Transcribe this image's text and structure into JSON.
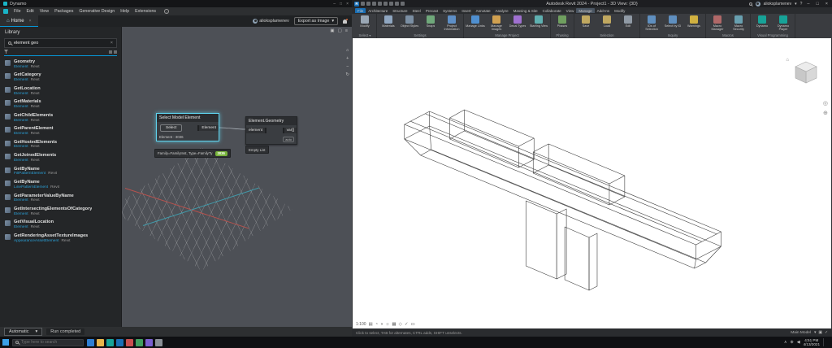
{
  "dynamo": {
    "window_title": "Dynamo",
    "window_controls": {
      "minimize": "–",
      "maximize": "□",
      "close": "×"
    },
    "menus": [
      {
        "label": "File"
      },
      {
        "label": "Edit"
      },
      {
        "label": "View"
      },
      {
        "label": "Packages"
      },
      {
        "label": "Generative Design"
      },
      {
        "label": "Help"
      },
      {
        "label": "Extensions"
      }
    ],
    "info_badge": "i",
    "home_tab": {
      "icon": "⌂",
      "label": "Home",
      "close": "×"
    },
    "account": {
      "user": "alioksplamenev"
    },
    "export_button": {
      "label": "Export as Image",
      "caret": "▾"
    },
    "library": {
      "title": "Library",
      "search": {
        "value": "element geo",
        "clear": "×"
      },
      "items": [
        {
          "name": "Geometry",
          "sub": "Element",
          "kind": "Revit"
        },
        {
          "name": "GetCategory",
          "sub": "Element",
          "kind": "Revit"
        },
        {
          "name": "GetLocation",
          "sub": "Element",
          "kind": "Revit"
        },
        {
          "name": "GetMaterials",
          "sub": "Element",
          "kind": "Revit"
        },
        {
          "name": "GetChildElements",
          "sub": "Element",
          "kind": "Revit"
        },
        {
          "name": "GetParentElement",
          "sub": "Element",
          "kind": "Revit"
        },
        {
          "name": "GetHostedElements",
          "sub": "Element",
          "kind": "Revit"
        },
        {
          "name": "GetJoinedElements",
          "sub": "Element",
          "kind": "Revit"
        },
        {
          "name": "GetByName",
          "sub": "FillPatternElement",
          "kind": "Revit"
        },
        {
          "name": "GetByName",
          "sub": "LinePatternElement",
          "kind": "Revit"
        },
        {
          "name": "GetParameterValueByName",
          "sub": "Element",
          "kind": "Revit"
        },
        {
          "name": "GetIntersectingElementsOfCategory",
          "sub": "Element",
          "kind": "Revit"
        },
        {
          "name": "GetVisualLocation",
          "sub": "Element",
          "kind": "Revit"
        },
        {
          "name": "GetRenderingAssetTextureImages",
          "sub": "AppearanceAssetElement",
          "kind": "Revit"
        }
      ]
    },
    "canvas": {
      "top_icons": [
        {
          "glyph": "▣",
          "name": "fit-view-icon"
        },
        {
          "glyph": "▢",
          "name": "zoom-window-icon"
        },
        {
          "glyph": "≡",
          "name": "canvas-menu-icon"
        }
      ],
      "side_icons": [
        {
          "glyph": "⌂",
          "name": "home-view-icon"
        },
        {
          "glyph": "+",
          "name": "zoom-in-icon"
        },
        {
          "glyph": "−",
          "name": "zoom-out-icon"
        },
        {
          "glyph": "↻",
          "name": "orbit-icon"
        }
      ],
      "select_node": {
        "title": "Select Model Element",
        "button": "Select",
        "out_port": "Element",
        "footer": "Element : 3036"
      },
      "watch": {
        "text": "Family=FamilyInst, Type=FamilyTy",
        "badge": "3036"
      },
      "geometry_node": {
        "title": "Element.Geometry",
        "in_port": "element",
        "out_port": "var[]",
        "lacing": "auto"
      },
      "preview_bubble": "Empty List"
    },
    "footer": {
      "run_mode": "Automatic",
      "caret": "▾",
      "status": "Run completed"
    }
  },
  "revit": {
    "title": "Autodesk Revit 2024 - Project1 - 3D View: {3D}",
    "qat": [
      {
        "name": "file-menu-icon"
      },
      {
        "name": "open-icon"
      },
      {
        "name": "save-icon"
      },
      {
        "name": "sync-icon"
      },
      {
        "name": "undo-icon"
      },
      {
        "name": "redo-icon"
      },
      {
        "name": "print-icon"
      },
      {
        "name": "measure-icon"
      }
    ],
    "titlebar_right": {
      "user": "alioksplamenev",
      "caret": "▾",
      "help": "?",
      "minimize": "–",
      "maximize": "□",
      "close": "×"
    },
    "tabs": [
      {
        "label": "File",
        "accent": "#1a6fb5"
      },
      {
        "label": "Architecture"
      },
      {
        "label": "Structure"
      },
      {
        "label": "Steel"
      },
      {
        "label": "Precast"
      },
      {
        "label": "Systems"
      },
      {
        "label": "Insert"
      },
      {
        "label": "Annotate"
      },
      {
        "label": "Analyze"
      },
      {
        "label": "Massing & Site"
      },
      {
        "label": "Collaborate"
      },
      {
        "label": "View"
      },
      {
        "label": "Manage",
        "accent": "#4a5562"
      },
      {
        "label": "Add-Ins"
      },
      {
        "label": "Modify"
      }
    ],
    "ribbon": {
      "panels": [
        {
          "caption": "Select ▾",
          "items": [
            {
              "label": "Modify",
              "color": "#9aa7b5"
            }
          ]
        },
        {
          "caption": "Settings",
          "items": [
            {
              "label": "Materials",
              "color": "#8fa6c0"
            },
            {
              "label": "Object Styles",
              "color": "#7b8fa3"
            },
            {
              "label": "Snaps",
              "color": "#6fa87a"
            },
            {
              "label": "Project Information",
              "color": "#5e8fc7"
            }
          ]
        },
        {
          "caption": "Manage Project",
          "items": [
            {
              "label": "Manage Links",
              "color": "#4f8fd0"
            },
            {
              "label": "Manage Images",
              "color": "#d0a050"
            },
            {
              "label": "Decal Types",
              "color": "#9f70d0"
            },
            {
              "label": "Starting View",
              "color": "#5fb0b0"
            }
          ]
        },
        {
          "caption": "Phasing",
          "items": [
            {
              "label": "Phases",
              "color": "#6f9f5f"
            }
          ]
        },
        {
          "caption": "Selection",
          "items": [
            {
              "label": "Save",
              "color": "#c0a860"
            },
            {
              "label": "Load",
              "color": "#c0a860"
            },
            {
              "label": "Edit",
              "color": "#909aa5"
            }
          ]
        },
        {
          "caption": "Inquiry",
          "items": [
            {
              "label": "IDs of Selection",
              "color": "#5f8fbf"
            },
            {
              "label": "Select by ID",
              "color": "#5f8fbf"
            },
            {
              "label": "Warnings",
              "color": "#d0b040"
            }
          ]
        },
        {
          "caption": "Macros",
          "items": [
            {
              "label": "Macro Manager",
              "color": "#b06868"
            },
            {
              "label": "Macro Security",
              "color": "#68a0b0"
            }
          ]
        },
        {
          "caption": "Visual Programming",
          "items": [
            {
              "label": "Dynamo",
              "color": "#17a398"
            },
            {
              "label": "Dynamo Player",
              "color": "#17a398"
            }
          ]
        }
      ]
    },
    "viewcube": {
      "home": "⌂"
    },
    "nav_icons": [
      {
        "glyph": "◎",
        "name": "steering-wheel-icon"
      },
      {
        "glyph": "⊕",
        "name": "zoom-icon"
      }
    ],
    "viewbar": {
      "scale": "1:100",
      "icons": [
        {
          "glyph": "▤",
          "name": "detail-level-icon"
        },
        {
          "glyph": "◔",
          "name": "visual-style-icon"
        },
        {
          "glyph": "◑",
          "name": "shadows-icon"
        },
        {
          "glyph": "☼",
          "name": "sun-path-icon"
        },
        {
          "glyph": "▦",
          "name": "crop-view-icon"
        },
        {
          "glyph": "◇",
          "name": "crop-region-icon"
        },
        {
          "glyph": "✓",
          "name": "reveal-hidden-icon"
        },
        {
          "glyph": "▭",
          "name": "temporary-hide-icon"
        }
      ]
    },
    "statusbar": {
      "hint": "Click to select, TAB for alternates, CTRL adds, SHIFT unselects.",
      "main_model": "Main Model",
      "filter_icons": [
        {
          "glyph": "▾",
          "name": "worksets-caret-icon"
        },
        {
          "glyph": "▣",
          "name": "editable-only-icon"
        },
        {
          "glyph": "✓",
          "name": "filter-icon"
        }
      ]
    }
  },
  "taskbar": {
    "search_placeholder": "Type here to search",
    "apps": [
      {
        "name": "taskbar-app-browser",
        "color": "#2f7fd4"
      },
      {
        "name": "taskbar-app-file-explorer",
        "color": "#e8b64c"
      },
      {
        "name": "taskbar-app-dynamo",
        "color": "#17a398"
      },
      {
        "name": "taskbar-app-revit",
        "color": "#1a6fb5"
      },
      {
        "name": "taskbar-app-mail",
        "color": "#c94f4f"
      },
      {
        "name": "taskbar-app-sheets",
        "color": "#3f9f5f"
      },
      {
        "name": "taskbar-app-teams",
        "color": "#7a5fd0"
      },
      {
        "name": "taskbar-app-settings",
        "color": "#8a8f96"
      }
    ],
    "tray": [
      {
        "glyph": "∧",
        "name": "tray-expand-icon"
      },
      {
        "glyph": "⊕",
        "name": "network-icon"
      },
      {
        "glyph": "◀",
        "name": "volume-icon"
      }
    ],
    "clock": {
      "time": "4:51 PM",
      "date": "4/13/2021"
    }
  }
}
